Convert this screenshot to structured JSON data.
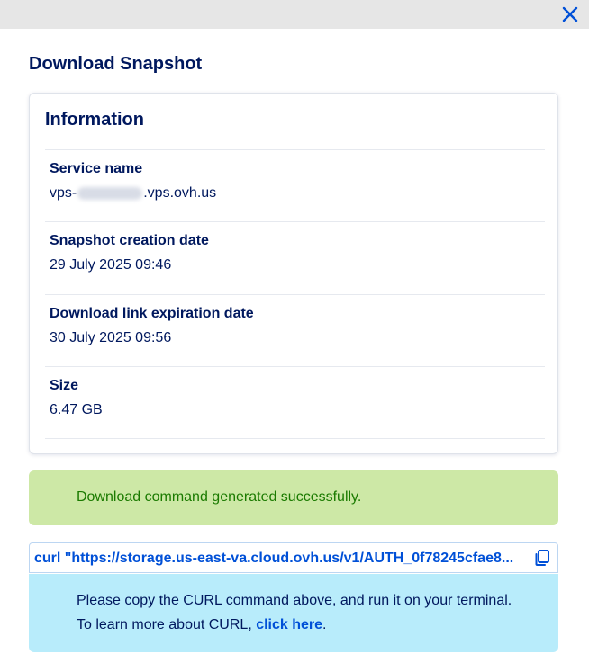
{
  "modal": {
    "close_icon": "close-icon",
    "title": "Download Snapshot"
  },
  "info": {
    "title": "Information",
    "service": {
      "label": "Service name",
      "value_prefix": "vps-",
      "value_suffix": ".vps.ovh.us"
    },
    "creation": {
      "label": "Snapshot creation date",
      "value": "29 July 2025 09:46"
    },
    "expiration": {
      "label": "Download link expiration date",
      "value": "30 July 2025 09:56"
    },
    "size": {
      "label": "Size",
      "value": "6.47 GB"
    }
  },
  "success": {
    "message": "Download command generated successfully."
  },
  "command": {
    "text": "curl \"https://storage.us-east-va.cloud.ovh.us/v1/AUTH_0f78245cfae8...",
    "copy_icon": "copy-icon"
  },
  "help": {
    "line1": "Please copy the CURL command above, and run it on your terminal.",
    "line2_prefix": "To learn more about CURL, ",
    "link": "click here",
    "line2_suffix": "."
  },
  "colors": {
    "primary_text": "#00185e",
    "link": "#0050d7",
    "success_bg": "#cde8a6",
    "success_text": "#1a7a00",
    "info_bg": "#b8ecfb",
    "topbar_bg": "#e6e6e6"
  }
}
